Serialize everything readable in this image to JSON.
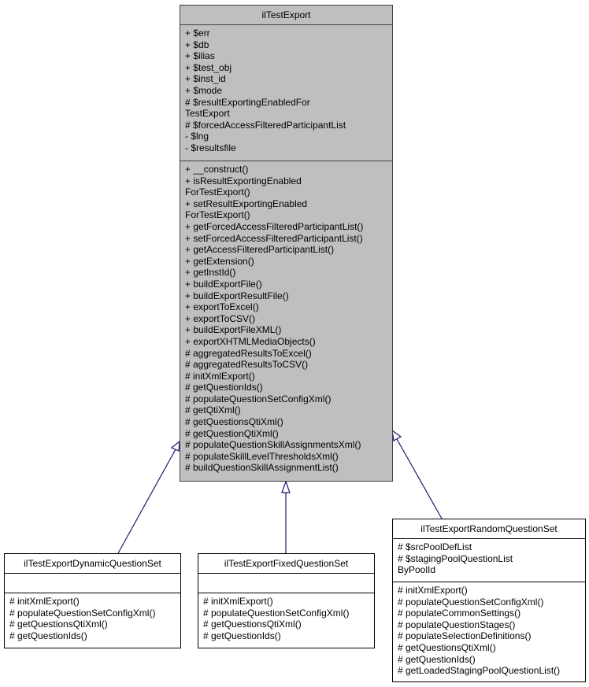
{
  "diagram": {
    "edge_color": "#191970",
    "main_fill": "#bfbfbf",
    "classes": {
      "main": {
        "name": "ilTestExport",
        "attributes": [
          "+ $err",
          "+ $db",
          "+ $ilias",
          "+ $test_obj",
          "+ $inst_id",
          "+ $mode",
          "# $resultExportingEnabledFor",
          "TestExport",
          "# $forcedAccessFilteredParticipantList",
          "- $lng",
          "- $resultsfile"
        ],
        "methods": [
          "+ __construct()",
          "+ isResultExportingEnabled",
          "ForTestExport()",
          "+ setResultExportingEnabled",
          "ForTestExport()",
          "+ getForcedAccessFilteredParticipantList()",
          "+ setForcedAccessFilteredParticipantList()",
          "+ getAccessFilteredParticipantList()",
          "+ getExtension()",
          "+ getInstId()",
          "+ buildExportFile()",
          "+ buildExportResultFile()",
          "+ exportToExcel()",
          "+ exportToCSV()",
          "+ buildExportFileXML()",
          "+ exportXHTMLMediaObjects()",
          "# aggregatedResultsToExcel()",
          "# aggregatedResultsToCSV()",
          "# initXmlExport()",
          "# getQuestionIds()",
          "# populateQuestionSetConfigXml()",
          "# getQtiXml()",
          "# getQuestionsQtiXml()",
          "# getQuestionQtiXml()",
          "# populateQuestionSkillAssignmentsXml()",
          "# populateSkillLevelThresholdsXml()",
          "# buildQuestionSkillAssignmentList()"
        ]
      },
      "dynamic": {
        "name": "ilTestExportDynamicQuestionSet",
        "attributes": [],
        "methods": [
          "# initXmlExport()",
          "# populateQuestionSetConfigXml()",
          "# getQuestionsQtiXml()",
          "# getQuestionIds()"
        ]
      },
      "fixed": {
        "name": "ilTestExportFixedQuestionSet",
        "attributes": [],
        "methods": [
          "# initXmlExport()",
          "# populateQuestionSetConfigXml()",
          "# getQuestionsQtiXml()",
          "# getQuestionIds()"
        ]
      },
      "random": {
        "name": "ilTestExportRandomQuestionSet",
        "attributes": [
          "# $srcPoolDefList",
          "# $stagingPoolQuestionList",
          "ByPoolId"
        ],
        "methods": [
          "# initXmlExport()",
          "# populateQuestionSetConfigXml()",
          "# populateCommonSettings()",
          "# populateQuestionStages()",
          "# populateSelectionDefinitions()",
          "# getQuestionsQtiXml()",
          "# getQuestionIds()",
          "# getLoadedStagingPoolQuestionList()"
        ]
      }
    },
    "edges": [
      {
        "from": "dynamic",
        "to": "main",
        "type": "inheritance"
      },
      {
        "from": "fixed",
        "to": "main",
        "type": "inheritance"
      },
      {
        "from": "random",
        "to": "main",
        "type": "inheritance"
      }
    ]
  }
}
